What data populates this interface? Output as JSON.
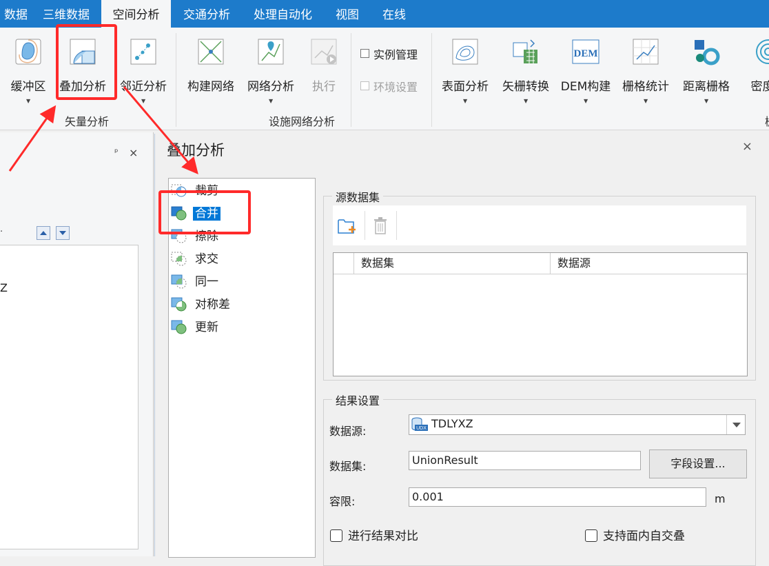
{
  "ribbon_tabs": [
    "数据",
    "三维数据",
    "空间分析",
    "交通分析",
    "处理自动化",
    "视图",
    "在线"
  ],
  "active_tab": "空间分析",
  "ribbon": {
    "buttons": [
      "缓冲区",
      "叠加分析",
      "邻近分析",
      "构建网络",
      "网络分析",
      "执行",
      "表面分析",
      "矢栅转换",
      "DEM构建",
      "栅格统计",
      "距离栅格",
      "密度分"
    ],
    "checkboxes": [
      "实例管理",
      "环境设置"
    ],
    "groups": [
      "矢量分析",
      "设施网络分析"
    ]
  },
  "left_panel": {
    "pin": "ᵖ",
    "close": "×",
    "fragment_dot": ".",
    "fragment_z": "Z"
  },
  "dialog": {
    "title": "叠加分析",
    "close": "×",
    "operations": [
      "裁剪",
      "合并",
      "擦除",
      "求交",
      "同一",
      "对称差",
      "更新"
    ],
    "selected_operation": "合并",
    "source_group": "源数据集",
    "table_headers": [
      "数据集",
      "数据源"
    ],
    "result_group": "结果设置",
    "datasource_label": "数据源:",
    "datasource_value": "TDLYXZ",
    "dataset_label": "数据集:",
    "dataset_value": "UnionResult",
    "field_settings_button": "字段设置...",
    "tolerance_label": "容限:",
    "tolerance_value": "0.001",
    "tolerance_unit": "m",
    "compare_checkbox": "进行结果对比",
    "self_intersect_checkbox": "支持面内自交叠"
  },
  "colors": {
    "tab_bar": "#1d7bcb",
    "highlight": "#0078d7",
    "annotation": "#ff2a2a"
  }
}
